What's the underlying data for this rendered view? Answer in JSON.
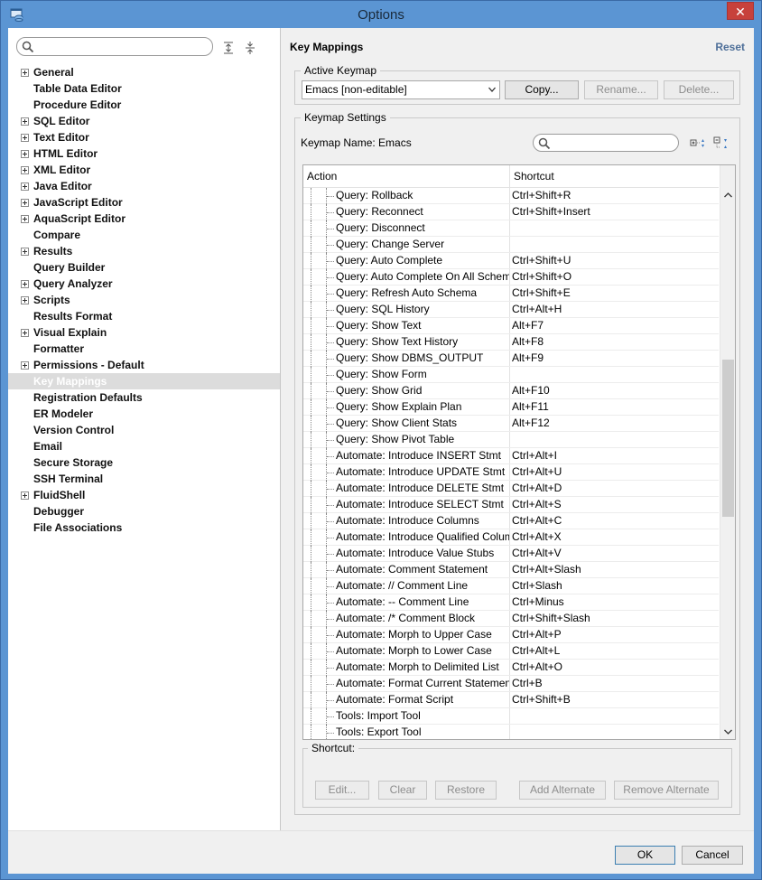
{
  "window": {
    "title": "Options"
  },
  "left": {
    "search_placeholder": "",
    "tree": [
      {
        "label": "General",
        "expandable": true
      },
      {
        "label": "Table Data Editor",
        "expandable": false
      },
      {
        "label": "Procedure Editor",
        "expandable": false
      },
      {
        "label": "SQL Editor",
        "expandable": true
      },
      {
        "label": "Text Editor",
        "expandable": true
      },
      {
        "label": "HTML Editor",
        "expandable": true
      },
      {
        "label": "XML Editor",
        "expandable": true
      },
      {
        "label": "Java Editor",
        "expandable": true
      },
      {
        "label": "JavaScript Editor",
        "expandable": true
      },
      {
        "label": "AquaScript Editor",
        "expandable": true
      },
      {
        "label": "Compare",
        "expandable": false
      },
      {
        "label": "Results",
        "expandable": true
      },
      {
        "label": "Query Builder",
        "expandable": false
      },
      {
        "label": "Query Analyzer",
        "expandable": true
      },
      {
        "label": "Scripts",
        "expandable": true
      },
      {
        "label": "Results Format",
        "expandable": false
      },
      {
        "label": "Visual Explain",
        "expandable": true
      },
      {
        "label": "Formatter",
        "expandable": false
      },
      {
        "label": "Permissions - Default",
        "expandable": true
      },
      {
        "label": "Key Mappings",
        "expandable": false,
        "selected": true
      },
      {
        "label": "Registration Defaults",
        "expandable": false
      },
      {
        "label": "ER Modeler",
        "expandable": false
      },
      {
        "label": "Version Control",
        "expandable": false
      },
      {
        "label": "Email",
        "expandable": false
      },
      {
        "label": "Secure Storage",
        "expandable": false
      },
      {
        "label": "SSH Terminal",
        "expandable": false
      },
      {
        "label": "FluidShell",
        "expandable": true
      },
      {
        "label": "Debugger",
        "expandable": false
      },
      {
        "label": "File Associations",
        "expandable": false
      }
    ]
  },
  "right": {
    "title": "Key Mappings",
    "reset_label": "Reset",
    "active_keymap": {
      "group_label": "Active Keymap",
      "selected": "Emacs [non-editable]",
      "copy_label": "Copy...",
      "rename_label": "Rename...",
      "delete_label": "Delete..."
    },
    "keymap_settings": {
      "group_label": "Keymap Settings",
      "name_label": "Keymap Name: Emacs",
      "search_placeholder": ""
    },
    "table": {
      "col_action": "Action",
      "col_shortcut": "Shortcut",
      "rows": [
        {
          "action": "Query: Rollback",
          "shortcut": "Ctrl+Shift+R"
        },
        {
          "action": "Query: Reconnect",
          "shortcut": "Ctrl+Shift+Insert"
        },
        {
          "action": "Query: Disconnect",
          "shortcut": ""
        },
        {
          "action": "Query: Change Server",
          "shortcut": ""
        },
        {
          "action": "Query: Auto Complete",
          "shortcut": "Ctrl+Shift+U"
        },
        {
          "action": "Query: Auto Complete On All Schemas",
          "shortcut": "Ctrl+Shift+O"
        },
        {
          "action": "Query: Refresh Auto Schema",
          "shortcut": "Ctrl+Shift+E"
        },
        {
          "action": "Query: SQL History",
          "shortcut": "Ctrl+Alt+H"
        },
        {
          "action": "Query: Show Text",
          "shortcut": "Alt+F7"
        },
        {
          "action": "Query: Show Text History",
          "shortcut": "Alt+F8"
        },
        {
          "action": "Query: Show DBMS_OUTPUT",
          "shortcut": "Alt+F9"
        },
        {
          "action": "Query: Show Form",
          "shortcut": ""
        },
        {
          "action": "Query: Show Grid",
          "shortcut": "Alt+F10"
        },
        {
          "action": "Query: Show Explain Plan",
          "shortcut": "Alt+F11"
        },
        {
          "action": "Query: Show Client Stats",
          "shortcut": "Alt+F12"
        },
        {
          "action": "Query: Show Pivot Table",
          "shortcut": ""
        },
        {
          "action": "Automate: Introduce INSERT Stmt",
          "shortcut": "Ctrl+Alt+I"
        },
        {
          "action": "Automate: Introduce UPDATE Stmt",
          "shortcut": "Ctrl+Alt+U"
        },
        {
          "action": "Automate: Introduce DELETE Stmt",
          "shortcut": "Ctrl+Alt+D"
        },
        {
          "action": "Automate: Introduce SELECT Stmt",
          "shortcut": "Ctrl+Alt+S"
        },
        {
          "action": "Automate: Introduce Columns",
          "shortcut": "Ctrl+Alt+C"
        },
        {
          "action": "Automate: Introduce Qualified Columns",
          "shortcut": "Ctrl+Alt+X"
        },
        {
          "action": "Automate: Introduce Value Stubs",
          "shortcut": "Ctrl+Alt+V"
        },
        {
          "action": "Automate: Comment Statement",
          "shortcut": "Ctrl+Alt+Slash"
        },
        {
          "action": "Automate: // Comment Line",
          "shortcut": "Ctrl+Slash"
        },
        {
          "action": "Automate: -- Comment Line",
          "shortcut": "Ctrl+Minus"
        },
        {
          "action": "Automate: /* Comment Block",
          "shortcut": "Ctrl+Shift+Slash"
        },
        {
          "action": "Automate: Morph to Upper Case",
          "shortcut": "Ctrl+Alt+P"
        },
        {
          "action": "Automate: Morph to Lower Case",
          "shortcut": "Ctrl+Alt+L"
        },
        {
          "action": "Automate: Morph to Delimited List",
          "shortcut": "Ctrl+Alt+O"
        },
        {
          "action": "Automate: Format Current Statement",
          "shortcut": "Ctrl+B"
        },
        {
          "action": "Automate: Format Script",
          "shortcut": "Ctrl+Shift+B"
        },
        {
          "action": "Tools: Import Tool",
          "shortcut": ""
        },
        {
          "action": "Tools: Export Tool",
          "shortcut": ""
        }
      ]
    },
    "shortcut_group": {
      "label": "Shortcut:",
      "edit_label": "Edit...",
      "clear_label": "Clear",
      "restore_label": "Restore",
      "add_alt_label": "Add Alternate",
      "remove_alt_label": "Remove Alternate"
    }
  },
  "footer": {
    "ok_label": "OK",
    "cancel_label": "Cancel"
  },
  "colors": {
    "title_bar": "#5b95d3",
    "close": "#c7413b",
    "link": "#4e6f99"
  }
}
